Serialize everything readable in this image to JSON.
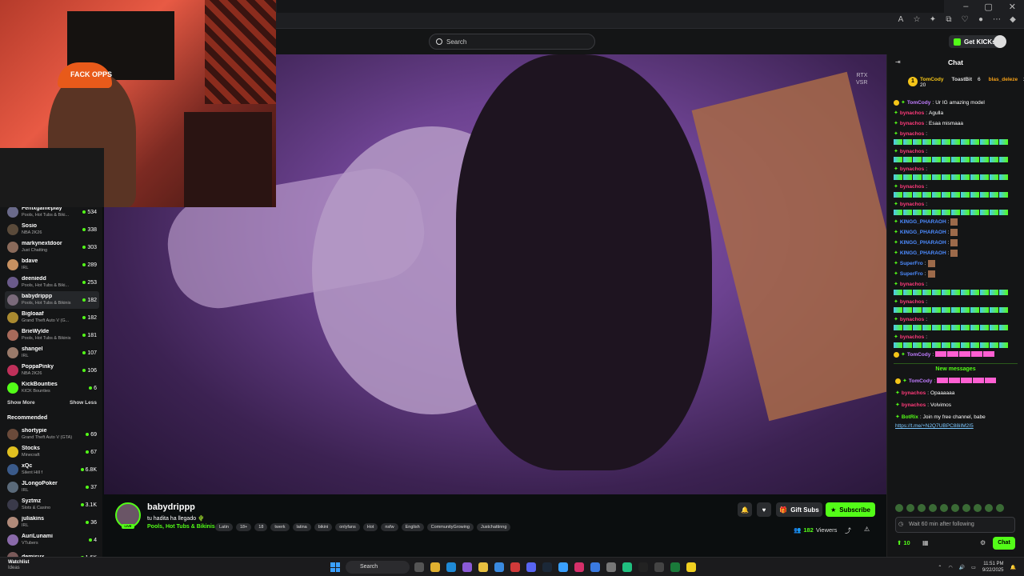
{
  "header": {
    "search_placeholder": "Search",
    "get_kicks_label": "Get KICKs"
  },
  "webcam": {
    "hat_text": "FACK OPPS"
  },
  "sidebar": {
    "following": [
      {
        "name": "Fenixgameplay",
        "category": "Pools, Hot Tubs & Biki...",
        "viewers": "534",
        "avatar": "#6a6a8a"
      },
      {
        "name": "Sosio",
        "category": "NBA 2K26",
        "viewers": "338",
        "avatar": "#5a4a3a"
      },
      {
        "name": "markynextdoor",
        "category": "Just Chatting",
        "viewers": "303",
        "avatar": "#8a6a5a"
      },
      {
        "name": "bdave",
        "category": "IRL",
        "viewers": "289",
        "avatar": "#c79060"
      },
      {
        "name": "deeniedd",
        "category": "Pools, Hot Tubs & Biki...",
        "viewers": "253",
        "avatar": "#6a5a8a"
      },
      {
        "name": "babydrippp",
        "category": "Pools, Hot Tubs & Bikinis",
        "viewers": "182",
        "avatar": "#7a6a7a",
        "active": true
      },
      {
        "name": "Bigloaaf",
        "category": "Grand Theft Auto V (G...",
        "viewers": "182",
        "avatar": "#aa8a30"
      },
      {
        "name": "BrieWylde",
        "category": "Pools, Hot Tubs & Bikinis",
        "viewers": "181",
        "avatar": "#a86a5a"
      },
      {
        "name": "shangel",
        "category": "IRL",
        "viewers": "107",
        "avatar": "#9a7a6a"
      },
      {
        "name": "PoppaPinky",
        "category": "NBA 2K26",
        "viewers": "106",
        "avatar": "#c0305a"
      },
      {
        "name": "KickBounties",
        "category": "KICK Bounties",
        "viewers": "6",
        "avatar": "#53fc18"
      }
    ],
    "show_more": "Show More",
    "show_less": "Show Less",
    "recommended_title": "Recommended",
    "recommended": [
      {
        "name": "shortypie",
        "category": "Grand Theft Auto V (GTA)",
        "viewers": "69",
        "avatar": "#6a4a3a"
      },
      {
        "name": "Stocks",
        "category": "Minecraft",
        "viewers": "67",
        "avatar": "#e0c020"
      },
      {
        "name": "xQc",
        "category": "Silent Hill f",
        "viewers": "6.8K",
        "avatar": "#3a5a8a"
      },
      {
        "name": "JLongoPoker",
        "category": "IRL",
        "viewers": "37",
        "avatar": "#5a6a7a"
      },
      {
        "name": "Syztmz",
        "category": "Slots & Casino",
        "viewers": "3.1K",
        "avatar": "#3a3a4a"
      },
      {
        "name": "juliakins",
        "category": "IRL",
        "viewers": "36",
        "avatar": "#b08a7a"
      },
      {
        "name": "AuriLunami",
        "category": "VTubers",
        "viewers": "4",
        "avatar": "#8a6aaa"
      },
      {
        "name": "demisux",
        "category": "",
        "viewers": "1.6K",
        "avatar": "#7a5a5a"
      }
    ]
  },
  "video": {
    "overlay_line1": "RTX",
    "overlay_line2": "VSR"
  },
  "stream": {
    "streamer": "babydrippp",
    "title": "tu hadita ha llegado",
    "category": "Pools, Hot Tubs & Bikinis",
    "tags": [
      "Latin",
      "18+",
      "18",
      "twerk",
      "latina",
      "bikini",
      "onlyfans",
      "Hot",
      "nsfw",
      "English",
      "CommunityGrowing",
      "Justchattinng"
    ],
    "gift_subs_label": "Gift Subs",
    "subscribe_label": "Subscribe",
    "viewers_count": "182",
    "viewers_label": "Viewers"
  },
  "chat": {
    "title": "Chat",
    "gifters": [
      {
        "rank": "1",
        "name": "TomCody",
        "count": "20"
      },
      {
        "rank": "",
        "name": "ToastBit",
        "count": "6"
      },
      {
        "rank": "",
        "name": "blas_deleze",
        "count": "2"
      }
    ],
    "messages": [
      {
        "user": "TomCody",
        "color": "#c07cff",
        "text": "Ur IG",
        "extra": "amazing model",
        "emote": "none"
      },
      {
        "user": "bynachos",
        "color": "#ff3a7a",
        "text": "Agulla",
        "emote": "none"
      },
      {
        "user": "bynachos",
        "color": "#ff3a7a",
        "text": "Esaa mismaaa",
        "emote": "none"
      },
      {
        "user": "bynachos",
        "color": "#ff3a7a",
        "text": "",
        "emote": "strip"
      },
      {
        "user": "bynachos",
        "color": "#ff3a7a",
        "text": "",
        "emote": "strip"
      },
      {
        "user": "bynachos",
        "color": "#ff3a7a",
        "text": "",
        "emote": "strip"
      },
      {
        "user": "bynachos",
        "color": "#ff3a7a",
        "text": "",
        "emote": "strip"
      },
      {
        "user": "bynachos",
        "color": "#ff3a7a",
        "text": "",
        "emote": "strip"
      },
      {
        "user": "KINGG_PHARAOH",
        "color": "#4c8bff",
        "text": "",
        "emote": "face"
      },
      {
        "user": "KINGG_PHARAOH",
        "color": "#4c8bff",
        "text": "",
        "emote": "face"
      },
      {
        "user": "KINGG_PHARAOH",
        "color": "#4c8bff",
        "text": "",
        "emote": "face"
      },
      {
        "user": "KINGG_PHARAOH",
        "color": "#4c8bff",
        "text": "",
        "emote": "face"
      },
      {
        "user": "SuperFro",
        "color": "#4c8bff",
        "text": "",
        "emote": "face"
      },
      {
        "user": "SuperFro",
        "color": "#4c8bff",
        "text": "",
        "emote": "face"
      },
      {
        "user": "bynachos",
        "color": "#ff3a7a",
        "text": "",
        "emote": "strip"
      },
      {
        "user": "bynachos",
        "color": "#ff3a7a",
        "text": "",
        "emote": "strip"
      },
      {
        "user": "bynachos",
        "color": "#ff3a7a",
        "text": "",
        "emote": "strip"
      },
      {
        "user": "bynachos",
        "color": "#ff3a7a",
        "text": "",
        "emote": "strip"
      },
      {
        "user": "TomCody",
        "color": "#c07cff",
        "text": "",
        "emote": "pink"
      }
    ],
    "new_messages_label": "New messages",
    "new_messages": [
      {
        "user": "TomCody",
        "color": "#c07cff",
        "text": "",
        "emote": "pink"
      },
      {
        "user": "bynachos",
        "color": "#ff3a7a",
        "text": "Opaaaaaa",
        "emote": "none"
      },
      {
        "user": "bynachos",
        "color": "#ff3a7a",
        "text": "Volvimos",
        "emote": "none"
      },
      {
        "user": "BotRix",
        "color": "#53fc18",
        "text": "Join my free channel, babe",
        "link": "https://t.me/+N2Q7UBPC88iIM2I5",
        "emote": "none"
      }
    ],
    "input_placeholder": "Wait 60 min after following",
    "kicks_count": "10",
    "send_label": "Chat"
  },
  "taskbar": {
    "widget_title": "Watchlist",
    "widget_sub": "Ideas",
    "search_label": "Search",
    "time": "11:51 PM",
    "date": "9/22/2025"
  }
}
